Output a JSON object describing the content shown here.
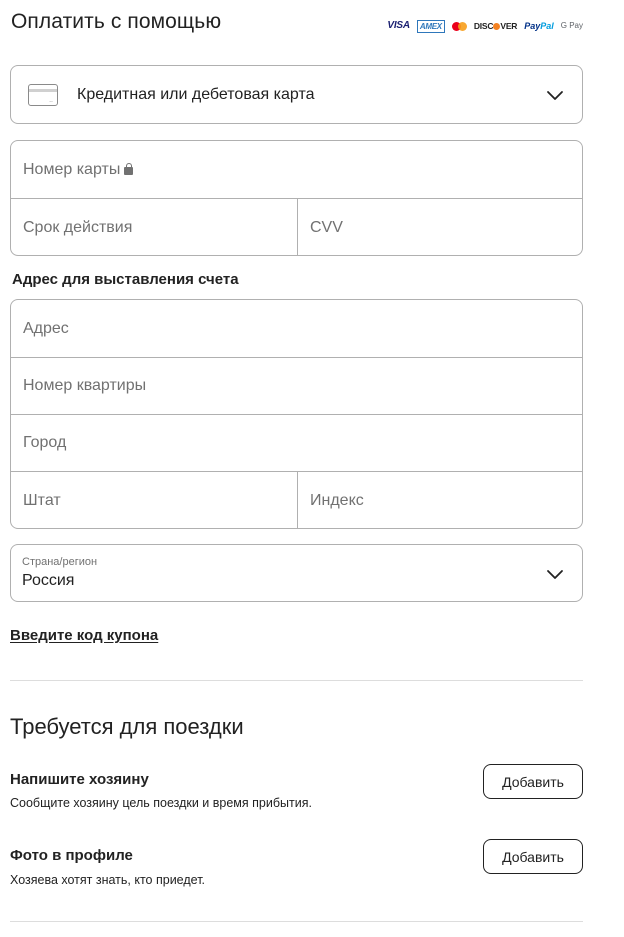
{
  "payment": {
    "title": "Оплатить с помощью",
    "brands": {
      "visa": "VISA",
      "amex": "AMEX",
      "mastercard_icon": "mastercard-logo",
      "discover_prefix": "DISC",
      "discover_suffix": "VER",
      "paypal_a": "Pay",
      "paypal_b": "Pal",
      "gpay": "G Pay"
    },
    "method": {
      "icon": "credit-card-icon",
      "label": "Кредитная или дебетовая карта",
      "chevron": "chevron-down-icon"
    }
  },
  "card_fields": {
    "number_placeholder": "Номер карты",
    "lock_icon": "lock-icon",
    "expiry_placeholder": "Срок действия",
    "cvv_placeholder": "CVV"
  },
  "billing": {
    "title": "Адрес для выставления счета",
    "address_placeholder": "Адрес",
    "apartment_placeholder": "Номер квартиры",
    "city_placeholder": "Город",
    "state_placeholder": "Штат",
    "zip_placeholder": "Индекс"
  },
  "country": {
    "label": "Страна/регион",
    "value": "Россия"
  },
  "coupon_link": "Введите код купона",
  "trip": {
    "title": "Требуется для поездки",
    "items": [
      {
        "title": "Напишите хозяину",
        "subtitle": "Сообщите хозяину цель поездки и время прибытия.",
        "button": "Добавить"
      },
      {
        "title": "Фото в профиле",
        "subtitle": "Хозяева хотят знать, кто приедет.",
        "button": "Добавить"
      }
    ]
  },
  "colors": {
    "text": "#222222",
    "muted": "#717171",
    "border": "#b0b0b0",
    "divider": "#dddddd"
  }
}
